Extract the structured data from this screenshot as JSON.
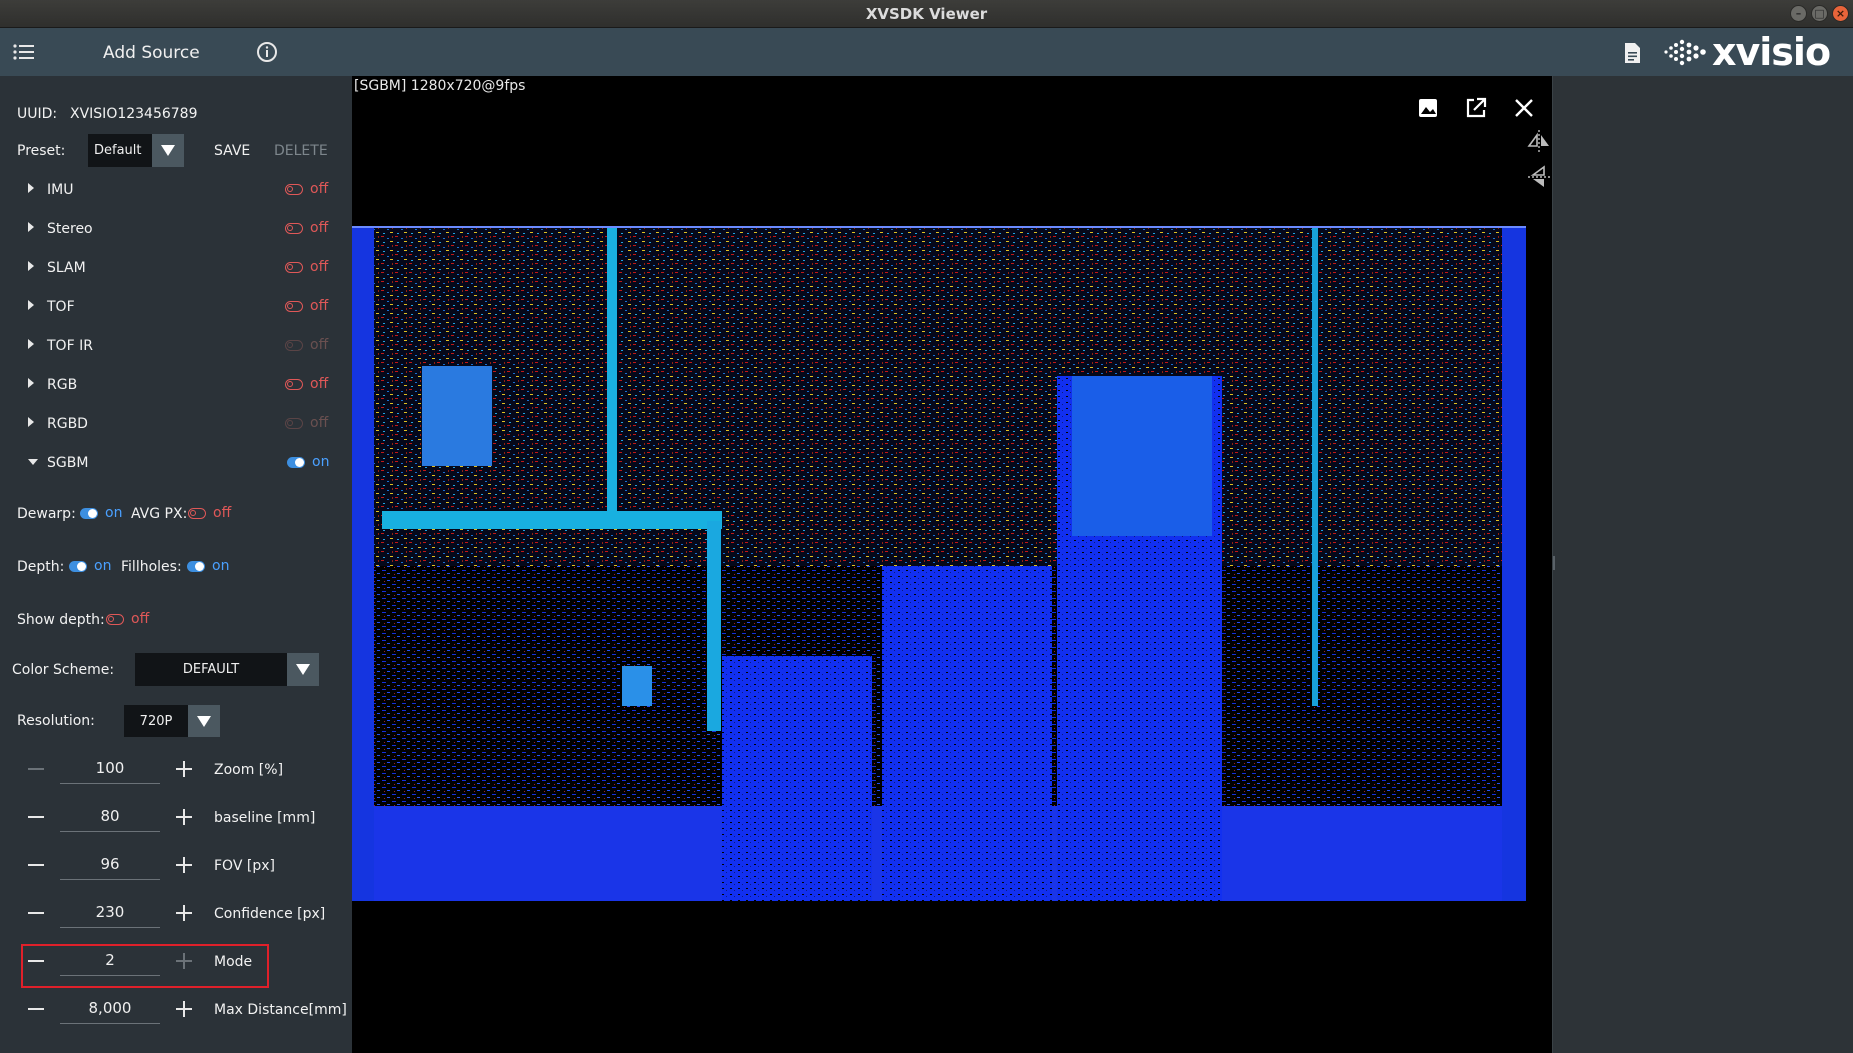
{
  "window": {
    "title": "XVSDK Viewer",
    "controls": [
      "–",
      "□",
      "×"
    ]
  },
  "toolbar": {
    "add_source_label": "Add Source",
    "brand": "xvisio"
  },
  "sidebar": {
    "uuid_label": "UUID:",
    "uuid_value": "XVISIO123456789",
    "preset_label": "Preset:",
    "preset_value": "Default",
    "save_label": "SAVE",
    "delete_label": "DELETE",
    "modules": [
      {
        "label": "IMU",
        "state": "off"
      },
      {
        "label": "Stereo",
        "state": "off"
      },
      {
        "label": "SLAM",
        "state": "off"
      },
      {
        "label": "TOF",
        "state": "off"
      },
      {
        "label": "TOF IR",
        "state": "off"
      },
      {
        "label": "RGB",
        "state": "off"
      },
      {
        "label": "RGBD",
        "state": "off"
      },
      {
        "label": "SGBM",
        "state": "on"
      }
    ],
    "dewarp_label": "Dewarp:",
    "dewarp_state": "on",
    "avgpx_label": "AVG PX:",
    "avgpx_state": "off",
    "depth_label": "Depth:",
    "depth_state": "on",
    "fillholes_label": "Fillholes:",
    "fillholes_state": "on",
    "showdepth_label": "Show depth:",
    "showdepth_state": "off",
    "colorscheme_label": "Color Scheme:",
    "colorscheme_value": "DEFAULT",
    "resolution_label": "Resolution:",
    "resolution_value": "720P",
    "steppers": [
      {
        "value": "100",
        "label": "Zoom [%]"
      },
      {
        "value": "80",
        "label": "baseline [mm]"
      },
      {
        "value": "96",
        "label": "FOV [px]"
      },
      {
        "value": "230",
        "label": "Confidence [px]"
      },
      {
        "value": "2",
        "label": "Mode"
      },
      {
        "value": "8,000",
        "label": "Max Distance[mm]"
      }
    ]
  },
  "viewer": {
    "stream_tag": "[SGBM]",
    "stream_info": "1280x720@9fps"
  },
  "colors": {
    "accent_on": "#4aa0ff",
    "off": "#e05858",
    "toolbar": "#394a55",
    "sidebar": "#2b3238",
    "highlight": "#e0202a"
  }
}
